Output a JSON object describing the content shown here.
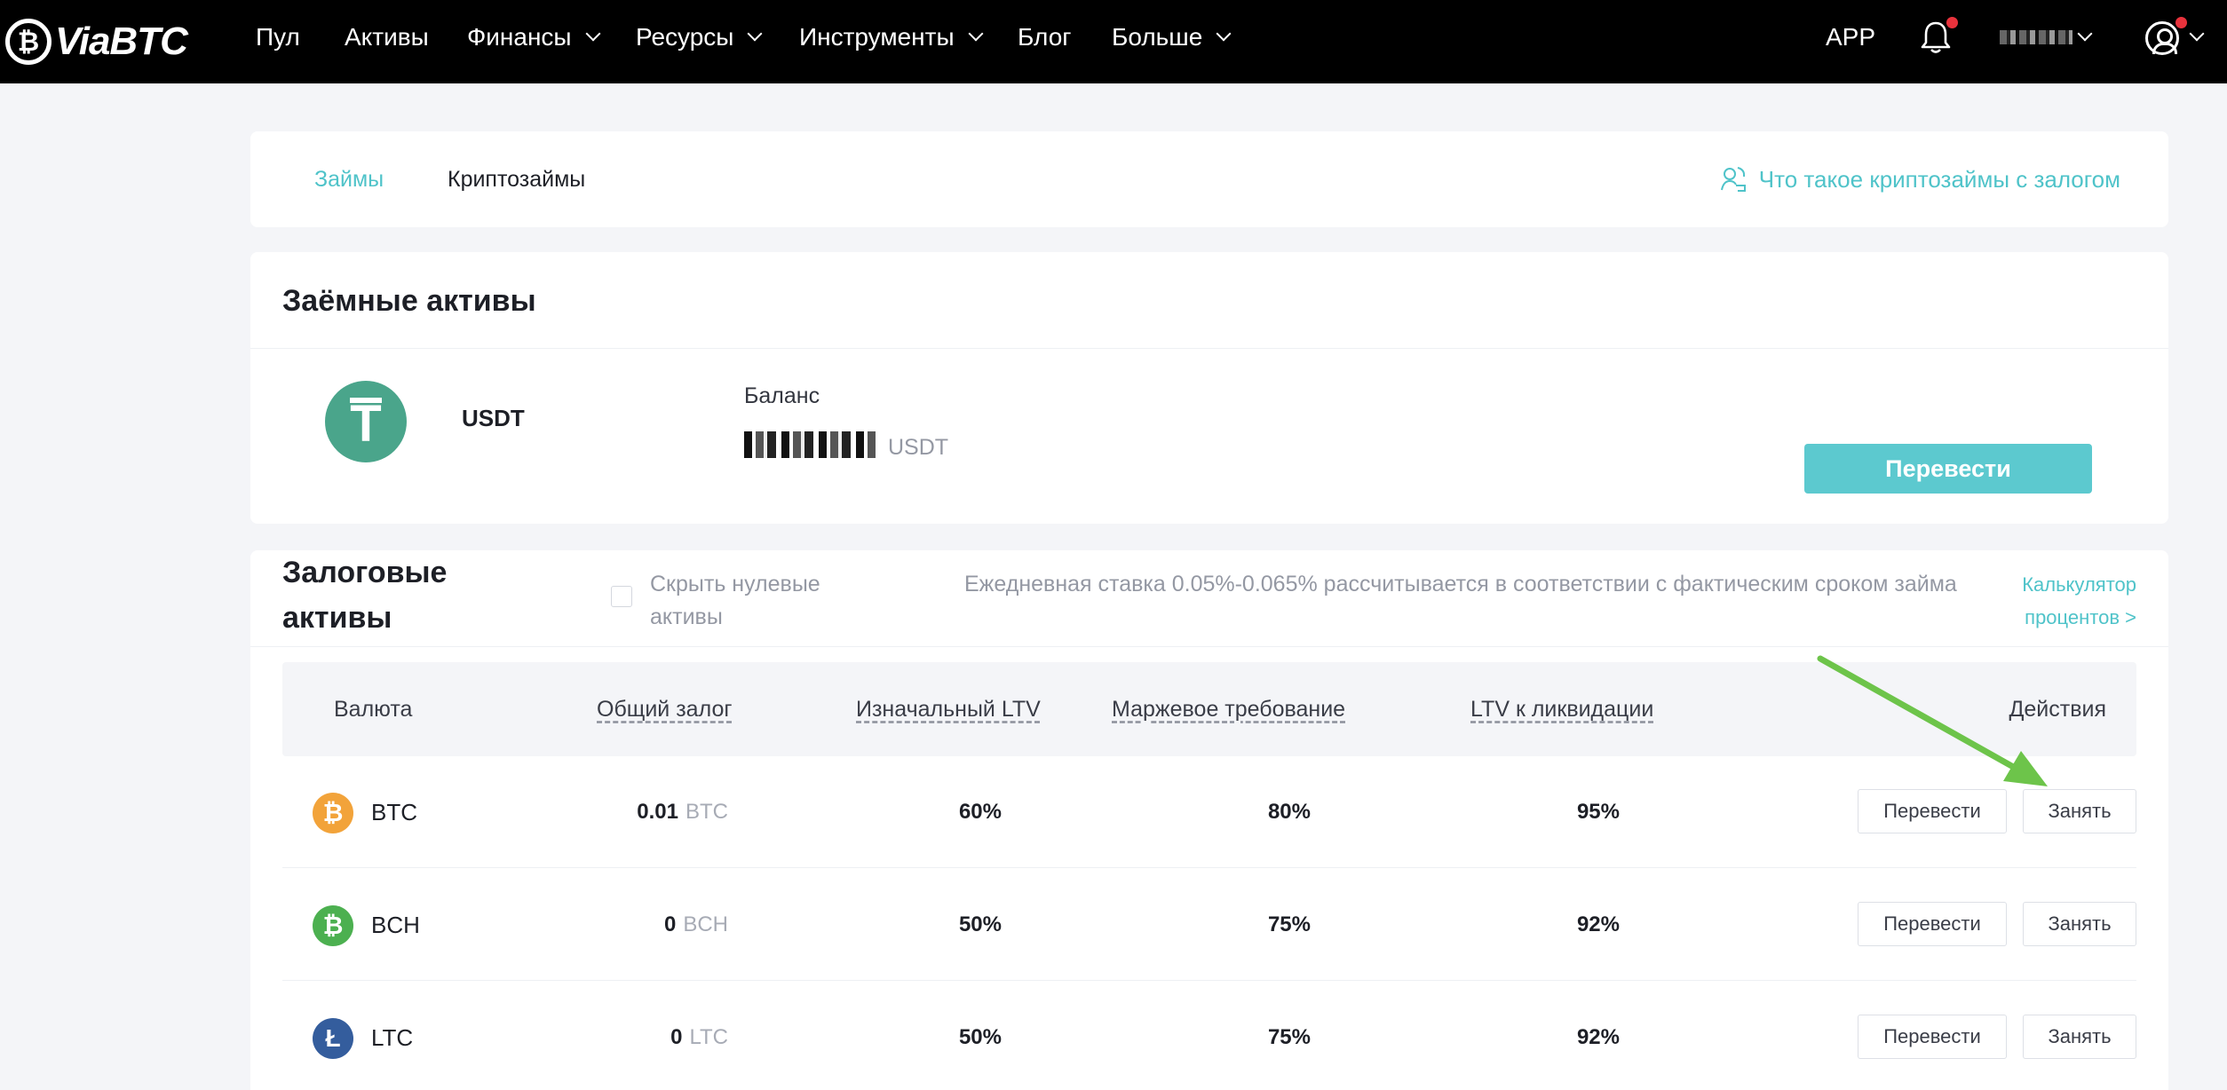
{
  "topbar": {
    "logo_mark": "₿",
    "logo_text": "ViaBTC",
    "nav": [
      {
        "label": "Пул"
      },
      {
        "label": "Активы"
      },
      {
        "label": "Финансы"
      },
      {
        "label": "Ресурсы"
      },
      {
        "label": "Инструменты"
      },
      {
        "label": "Блог"
      },
      {
        "label": "Больше"
      }
    ],
    "app_label": "APP"
  },
  "tabs": {
    "loans": "Займы",
    "crypto_loans": "Криптозаймы",
    "help_link": "Что такое криптозаймы с залогом"
  },
  "borrow": {
    "title": "Заёмные активы",
    "coin": "USDT",
    "coin_symbol": "T",
    "balance_label": "Баланс",
    "balance_unit": "USDT",
    "transfer_button": "Перевести"
  },
  "collateral": {
    "title": "Залоговые активы",
    "hide_zero_label": "Скрыть нулевые активы",
    "rate_note": "Ежедневная ставка 0.05%-0.065% рассчитывается в соответствии с фактическим сроком займа",
    "calc_link": "Калькулятор процентов  >",
    "columns": {
      "currency": "Валюта",
      "total": "Общий залог",
      "initial_ltv": "Изначальный LTV",
      "margin": "Маржевое требование",
      "liquidation": "LTV к ликвидации",
      "actions": "Действия"
    },
    "rows": [
      {
        "coin": "BTC",
        "symbol": "₿",
        "color": "#f2a33a",
        "amount": "0.01",
        "unit": "BTC",
        "initial_ltv": "60%",
        "margin": "80%",
        "liquidation": "95%",
        "transfer": "Перевести",
        "borrow": "Занять"
      },
      {
        "coin": "BCH",
        "symbol": "₿",
        "color": "#4cb050",
        "amount": "0",
        "unit": "BCH",
        "initial_ltv": "50%",
        "margin": "75%",
        "liquidation": "92%",
        "transfer": "Перевести",
        "borrow": "Занять"
      },
      {
        "coin": "LTC",
        "symbol": "Ł",
        "color": "#345d9d",
        "amount": "0",
        "unit": "LTC",
        "initial_ltv": "50%",
        "margin": "75%",
        "liquidation": "92%",
        "transfer": "Перевести",
        "borrow": "Занять"
      }
    ]
  },
  "colors": {
    "accent": "#5cc9cf",
    "link": "#4fc3c9",
    "annotation_arrow": "#6dc44a"
  }
}
